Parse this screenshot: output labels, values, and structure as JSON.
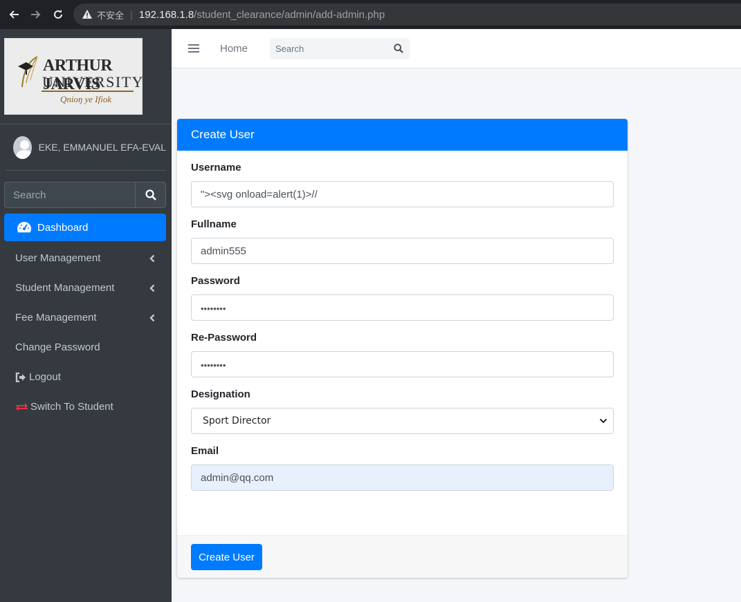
{
  "browser": {
    "insecure_label": "不安全",
    "url_host": "192.168.1.8",
    "url_path": "/student_clearance/admin/add-admin.php"
  },
  "sidebar": {
    "logo": {
      "line1": "ARTHUR JARVIS",
      "line2": "UNIVERSITY",
      "motto": "Qnioŋ ye Ifiok"
    },
    "user_name": "EKE, EMMANUEL EFA-EVAL",
    "search_placeholder": "Search",
    "menu": [
      {
        "label": "Dashboard",
        "icon": "tachometer-icon",
        "active": true
      },
      {
        "label": "User Management",
        "icon": "chevron-left-icon"
      },
      {
        "label": "Student Management",
        "icon": "chevron-left-icon"
      },
      {
        "label": "Fee Management",
        "icon": "chevron-left-icon"
      },
      {
        "label": "Change Password"
      },
      {
        "label": "Logout",
        "icon": "sign-out-icon"
      },
      {
        "label": "Switch To Student",
        "icon": "exchange-icon",
        "icon_color": "#dc3545"
      }
    ]
  },
  "topnav": {
    "home_label": "Home",
    "search_placeholder": "Search"
  },
  "form": {
    "title": "Create User",
    "username": {
      "label": "Username",
      "value": "\"><svg onload=alert(1)>//"
    },
    "fullname": {
      "label": "Fullname",
      "value": "admin555"
    },
    "password": {
      "label": "Password",
      "value": "••••••••"
    },
    "repassword": {
      "label": "Re-Password",
      "value": "••••••••"
    },
    "designation": {
      "label": "Designation",
      "value": "Sport Director"
    },
    "email": {
      "label": "Email",
      "value": "admin@qq.com"
    },
    "submit_label": "Create User"
  },
  "colors": {
    "primary": "#007bff",
    "sidebar_bg": "#343a40",
    "danger": "#dc3545"
  }
}
